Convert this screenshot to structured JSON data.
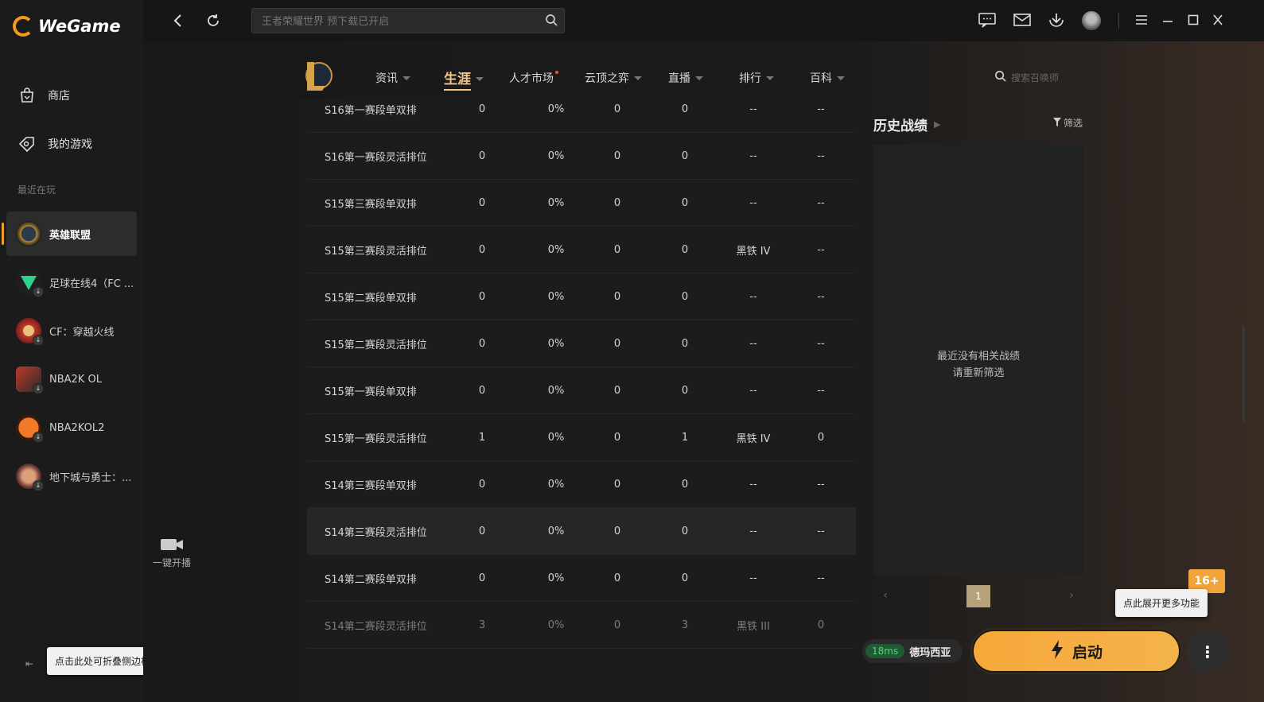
{
  "app": {
    "name": "WeGame"
  },
  "sidebar": {
    "nav": [
      {
        "label": "商店",
        "icon": "bag-icon"
      },
      {
        "label": "我的游戏",
        "icon": "gamepad-icon"
      }
    ],
    "recent_label": "最近在玩",
    "games": [
      {
        "label": "英雄联盟",
        "active": true
      },
      {
        "label": "足球在线4（FC ..."
      },
      {
        "label": "CF：穿越火线"
      },
      {
        "label": "NBA2K OL"
      },
      {
        "label": "NBA2KOL2"
      },
      {
        "label": "地下城与勇士：..."
      }
    ],
    "collapse_tip": "点击此处可折叠侧边栏"
  },
  "topbar": {
    "search_placeholder": "王者荣耀世界 预下载已开启"
  },
  "game_nav": {
    "items": [
      {
        "label": "资讯"
      },
      {
        "label": "生涯"
      },
      {
        "label": "人才市场"
      },
      {
        "label": "云顶之弈"
      },
      {
        "label": "直播"
      },
      {
        "label": "排行"
      },
      {
        "label": "百科"
      }
    ],
    "search_placeholder": "搜索召唤师"
  },
  "table": {
    "rows": [
      [
        "S16第一赛段单双排",
        "0",
        "0%",
        "0",
        "0",
        "--",
        "--"
      ],
      [
        "S16第一赛段灵活排位",
        "0",
        "0%",
        "0",
        "0",
        "--",
        "--"
      ],
      [
        "S15第三赛段单双排",
        "0",
        "0%",
        "0",
        "0",
        "--",
        "--"
      ],
      [
        "S15第三赛段灵活排位",
        "0",
        "0%",
        "0",
        "0",
        "黑铁 IV",
        "--"
      ],
      [
        "S15第二赛段单双排",
        "0",
        "0%",
        "0",
        "0",
        "--",
        "--"
      ],
      [
        "S15第二赛段灵活排位",
        "0",
        "0%",
        "0",
        "0",
        "--",
        "--"
      ],
      [
        "S15第一赛段单双排",
        "0",
        "0%",
        "0",
        "0",
        "--",
        "--"
      ],
      [
        "S15第一赛段灵活排位",
        "1",
        "0%",
        "0",
        "1",
        "黑铁 IV",
        "0"
      ],
      [
        "S14第三赛段单双排",
        "0",
        "0%",
        "0",
        "0",
        "--",
        "--"
      ],
      [
        "S14第三赛段灵活排位",
        "0",
        "0%",
        "0",
        "0",
        "--",
        "--"
      ],
      [
        "S14第二赛段单双排",
        "0",
        "0%",
        "0",
        "0",
        "--",
        "--"
      ],
      [
        "S14第二赛段灵活排位",
        "3",
        "0%",
        "0",
        "3",
        "黑铁 III",
        "0"
      ]
    ]
  },
  "live": {
    "label": "一键开播"
  },
  "history": {
    "title": "历史战绩",
    "filter": "筛选",
    "empty_line1": "最近没有相关战绩",
    "empty_line2": "请重新筛选",
    "page": "1"
  },
  "footer": {
    "ping": "18ms",
    "server": "德玛西亚",
    "launch": "启动",
    "more_tip": "点此展开更多功能",
    "age_badge": "16+"
  },
  "colors": {
    "accent": "#f2c78b",
    "launch": "#f7a83a",
    "ping": "#56d27d"
  }
}
